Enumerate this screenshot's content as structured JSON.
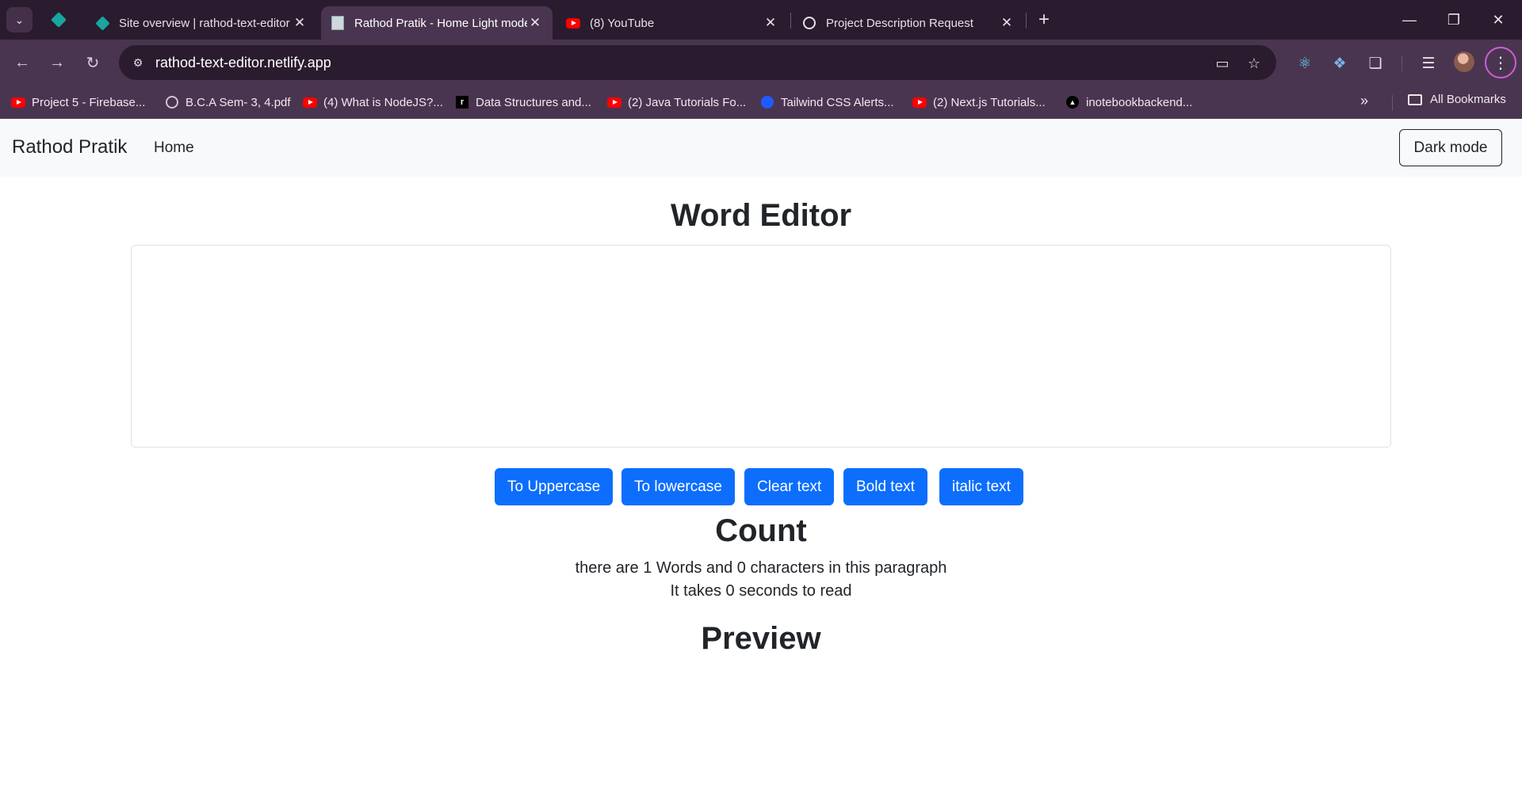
{
  "browser": {
    "tabs": [
      {
        "title": "Site overview | rathod-text-editor"
      },
      {
        "title": "Rathod Pratik - Home Light mode"
      },
      {
        "title": "(8) YouTube"
      },
      {
        "title": "Project Description Request"
      }
    ],
    "url": "rathod-text-editor.netlify.app",
    "bookmarks": [
      {
        "label": "Project 5 - Firebase...",
        "icon": "youtube-icon"
      },
      {
        "label": "B.C.A Sem- 3, 4.pdf",
        "icon": "globe-icon"
      },
      {
        "label": "(4) What is NodeJS?...",
        "icon": "youtube-icon"
      },
      {
        "label": "Data Structures and...",
        "icon": "r-icon"
      },
      {
        "label": "(2) Java Tutorials Fo...",
        "icon": "youtube-icon"
      },
      {
        "label": "Tailwind CSS Alerts...",
        "icon": "tailwind-icon"
      },
      {
        "label": "(2) Next.js Tutorials...",
        "icon": "youtube-icon"
      },
      {
        "label": "inotebookbackend...",
        "icon": "render-icon"
      }
    ],
    "all_bookmarks": "All Bookmarks"
  },
  "navbar": {
    "brand": "Rathod Pratik",
    "home": "Home",
    "dark_mode": "Dark mode"
  },
  "editor": {
    "heading": "Word Editor",
    "text": "",
    "buttons": [
      "To Uppercase",
      "To lowercase",
      "Clear text",
      "Bold text",
      "italic text"
    ]
  },
  "count": {
    "heading": "Count",
    "summary": "there are 1 Words and 0 characters in this paragraph",
    "read_time": "It takes 0 seconds to read"
  },
  "preview": {
    "heading": "Preview",
    "text": ""
  },
  "colors": {
    "primary": "#0d6efd",
    "navbar_bg": "#f8f9fa",
    "chrome_frame": "#2b1b2e",
    "chrome_toolbar": "#4a3550"
  }
}
